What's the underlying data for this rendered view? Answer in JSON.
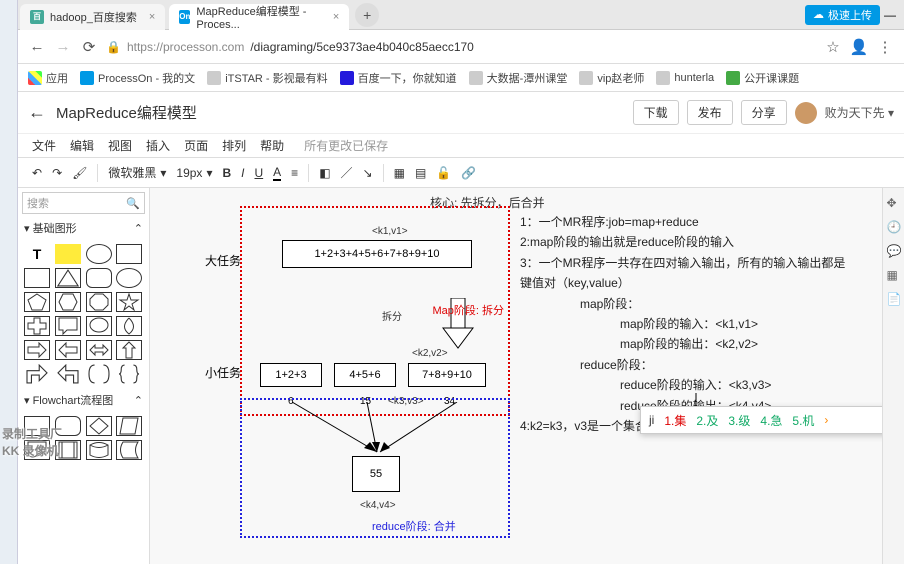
{
  "browser": {
    "tabs": [
      {
        "icon": "百",
        "label": "hadoop_百度搜索"
      },
      {
        "icon": "On",
        "label": "MapReduce编程模型 - Proces..."
      }
    ],
    "cloud": "极速上传",
    "url_host": "https://processon.com",
    "url_path": "/diagraming/5ce9373ae4b040c85aecc170"
  },
  "bookmarks": {
    "apps": "应用",
    "items": [
      "ProcessOn - 我的文",
      "iTSTAR - 影视最有料",
      "百度一下，你就知道",
      "大数据-潭州课堂",
      "vip赵老师",
      "hunterla",
      "公开课课题"
    ]
  },
  "header": {
    "title": "MapReduce编程模型",
    "download": "下载",
    "publish": "发布",
    "share": "分享",
    "user": "败为天下先 ▾"
  },
  "menu": [
    "文件",
    "编辑",
    "视图",
    "插入",
    "页面",
    "排列",
    "帮助"
  ],
  "menu_saved": "所有更改已保存",
  "toolbar": {
    "font": "微软雅黑",
    "size": "19px"
  },
  "sidebar": {
    "search": "搜索",
    "cat_basic": "基础图形",
    "cat_flow": "Flowchart流程图",
    "watermark1": "录制工具厂",
    "watermark2": "KK 录像机"
  },
  "canvas": {
    "core": "核心: 先拆分，后合并",
    "big": "大任务",
    "small": "小任务",
    "task_main": "1+2+3+4+5+6+7+8+9+10",
    "task1": "1+2+3",
    "task2": "4+5+6",
    "task3": "7+8+9+10",
    "result": "55",
    "kv1": "<k1,v1>",
    "kv2": "<k2,v2>",
    "kv3": "<k3,v3>",
    "kv4": "<k4,v4>",
    "n6": "6",
    "n15": "15",
    "n34": "34",
    "split": "拆分",
    "map_label": "Map阶段: 拆分",
    "reduce_label": "reduce阶段: 合并",
    "txt1": "1：一个MR程序:job=map+reduce",
    "txt2": "2:map阶段的输出就是reduce阶段的输入",
    "txt3": "3：一个MR程序一共存在四对输入输出，所有的输入输出都是",
    "txt3b": "键值对（key,value）",
    "txt_map": "map阶段：",
    "txt_map_in": "map阶段的输入：<k1,v1>",
    "txt_map_out": "map阶段的输出：<k2,v2>",
    "txt_red": "reduce阶段：",
    "txt_red_in": "reduce阶段的输入：<k3,v3>",
    "txt_red_out": "reduce阶段的输出：<k4,v4>",
    "txt4": "4:k2=k3，v3是一个集合，ji"
  },
  "ime": {
    "typed": "ji",
    "c1": "1.集",
    "c2": "2.及",
    "c3": "3.级",
    "c4": "4.急",
    "c5": "5.机"
  }
}
